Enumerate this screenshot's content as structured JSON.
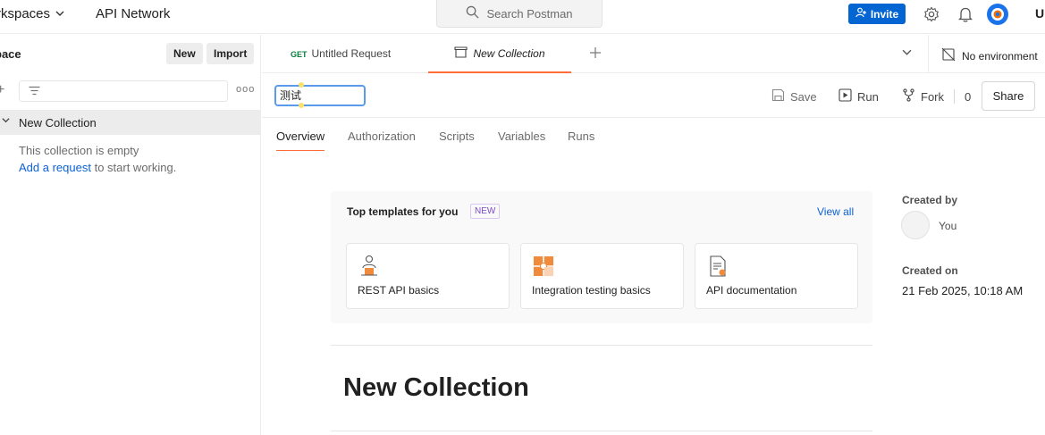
{
  "topbar": {
    "workspaces_label": "rkspaces",
    "api_network_label": "API Network",
    "search_placeholder": "Search Postman",
    "invite_label": "Invite",
    "upgrade_label": "Up",
    "accent_color": "#0265d2"
  },
  "sidebar": {
    "title": "pace",
    "new_label": "New",
    "import_label": "Import",
    "collection_name": "New Collection",
    "empty_text": "This collection is empty",
    "add_request_link": "Add a request",
    "add_request_suffix": "to start working."
  },
  "tabs": [
    {
      "method": "GET",
      "label": "Untitled Request"
    },
    {
      "label": "New Collection",
      "active": true
    }
  ],
  "environment": {
    "label": "No environment"
  },
  "collection_header": {
    "name_input_value": "测试",
    "save_label": "Save",
    "run_label": "Run",
    "fork_label": "Fork",
    "fork_count": "0",
    "share_label": "Share"
  },
  "subtabs": [
    "Overview",
    "Authorization",
    "Scripts",
    "Variables",
    "Runs"
  ],
  "templates": {
    "title": "Top templates for you",
    "badge": "NEW",
    "view_all": "View all",
    "items": [
      {
        "name": "REST API basics",
        "icon": "rest-api-icon"
      },
      {
        "name": "Integration testing basics",
        "icon": "puzzle-icon"
      },
      {
        "name": "API documentation",
        "icon": "document-icon"
      }
    ]
  },
  "collection_title": "New Collection",
  "info": {
    "created_by_label": "Created by",
    "created_by_value": "You",
    "created_on_label": "Created on",
    "created_on_value": "21 Feb 2025, 10:18 AM"
  },
  "colors": {
    "brand_orange": "#ff6c37",
    "link_blue": "#0b62d6",
    "badge_purple": "#7d4bc7"
  }
}
